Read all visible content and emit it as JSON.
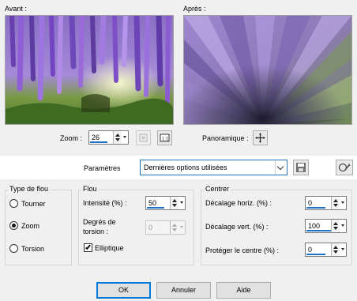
{
  "preview": {
    "before_label": "Avant :",
    "after_label": "Après :"
  },
  "zoom": {
    "label": "Zoom :",
    "value": "26"
  },
  "pan": {
    "label": "Panoramique :"
  },
  "params": {
    "label": "Paramètres",
    "preset": "Dernières options utilisées"
  },
  "blur_type": {
    "title": "Type de flou",
    "options": [
      "Tourner",
      "Zoom",
      "Torsion"
    ],
    "selected": "Zoom"
  },
  "blur": {
    "title": "Flou",
    "intensity_label": "Intensité (%) :",
    "intensity_value": "50",
    "twist_label_1": "Degrés de",
    "twist_label_2": "torsion :",
    "twist_value": "0",
    "elliptical_label": "Elliptique",
    "elliptical_checked": true
  },
  "center": {
    "title": "Centrer",
    "h_offset_label": "Décalage horiz. (%) :",
    "h_offset_value": "0",
    "v_offset_label": "Décalage vert. (%) :",
    "v_offset_value": "100",
    "protect_label": "Protéger le centre (%) :",
    "protect_value": "0"
  },
  "buttons": {
    "ok": "OK",
    "cancel": "Annuler",
    "help": "Aide"
  },
  "colors": {
    "accent": "#0078d7",
    "spin_bar": "#1e73c8"
  }
}
